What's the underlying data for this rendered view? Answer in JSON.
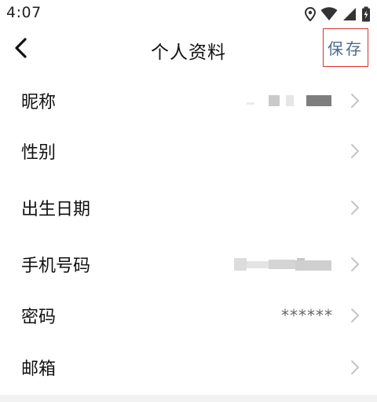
{
  "status_bar": {
    "time": "4:07",
    "icons": [
      "location-icon",
      "wifi-icon",
      "signal-icon",
      "battery-charging-icon"
    ]
  },
  "header": {
    "back_icon": "chevron-left-icon",
    "title": "个人资料",
    "save_label": "保存"
  },
  "rows": [
    {
      "label": "昵称",
      "value": "",
      "value_obscured": true
    },
    {
      "label": "性别",
      "value": ""
    },
    {
      "label": "出生日期",
      "value": ""
    },
    {
      "label": "手机号码",
      "value": "",
      "value_obscured": true
    },
    {
      "label": "密码",
      "value": "******"
    },
    {
      "label": "邮箱",
      "value": ""
    }
  ],
  "colors": {
    "save_text": "#4a6d8c",
    "save_border": "#e03030",
    "chevron": "#c4c4c4"
  }
}
